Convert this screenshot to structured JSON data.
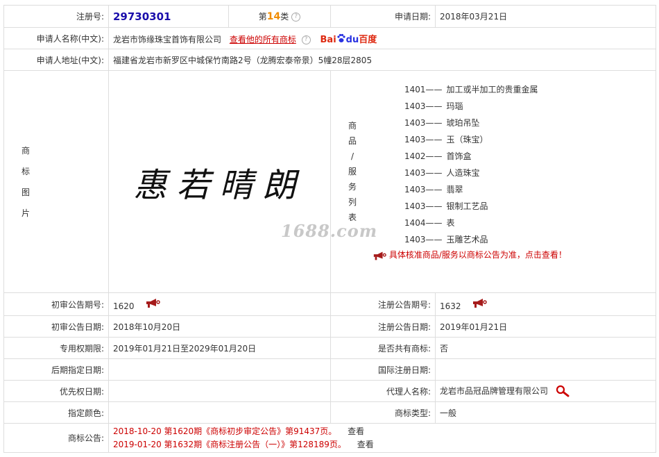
{
  "labels": {
    "reg_no": "注册号:",
    "apply_date": "申请日期:",
    "applicant_name": "申请人名称(中文):",
    "applicant_addr": "申请人地址(中文):",
    "mark_image": [
      "商",
      "标",
      "图",
      "片"
    ],
    "goods_services": [
      "商",
      "品",
      "/",
      "服",
      "务",
      "列",
      "表"
    ],
    "prelim_pub_no": "初审公告期号:",
    "reg_pub_no": "注册公告期号:",
    "prelim_pub_date": "初审公告日期:",
    "reg_pub_date": "注册公告日期:",
    "exclusive_period": "专用权期限:",
    "shared_mark": "是否共有商标:",
    "later_designation": "后期指定日期:",
    "intl_reg_date": "国际注册日期:",
    "priority_date": "优先权日期:",
    "agent_name": "代理人名称:",
    "designated_color": "指定颜色:",
    "mark_type": "商标类型:",
    "mark_announcement": "商标公告:"
  },
  "record": {
    "reg_no": "29730301",
    "class_prefix": "第",
    "class_num": "14",
    "class_suffix": "类",
    "apply_date": "2018年03月21日",
    "applicant_name": "龙岩市饰缘珠宝首饰有限公司",
    "view_all_link": "查看他的所有商标",
    "baidu": {
      "a": "Bai",
      "b": "du",
      "c": "百度"
    },
    "applicant_addr": "福建省龙岩市新罗区中城保竹南路2号（龙腾宏泰帝景）5幢28层2805",
    "mark_text": "惠若晴朗",
    "prelim_pub_no": "1620",
    "reg_pub_no": "1632",
    "prelim_pub_date": "2018年10月20日",
    "reg_pub_date": "2019年01月21日",
    "exclusive_period": "2019年01月21日至2029年01月20日",
    "shared_mark": "否",
    "later_designation": "",
    "intl_reg_date": "",
    "priority_date": "",
    "agent_name": "龙岩市品冠品牌管理有限公司",
    "designated_color": "",
    "mark_type": "一般"
  },
  "goods": [
    {
      "code": "1401",
      "name": "加工或半加工的贵重金属"
    },
    {
      "code": "1403",
      "name": "玛瑙"
    },
    {
      "code": "1403",
      "name": "琥珀吊坠"
    },
    {
      "code": "1403",
      "name": "玉（珠宝）"
    },
    {
      "code": "1402",
      "name": "首饰盒"
    },
    {
      "code": "1403",
      "name": "人造珠宝"
    },
    {
      "code": "1403",
      "name": "翡翠"
    },
    {
      "code": "1403",
      "name": "银制工艺品"
    },
    {
      "code": "1404",
      "name": "表"
    },
    {
      "code": "1403",
      "name": "玉雕艺术品"
    }
  ],
  "goods_dash": "——",
  "goods_note": "具体核准商品/服务以商标公告为准，点击查看！",
  "watermark": "1688.com",
  "announcements": [
    {
      "text": "2018-10-20 第1620期《商标初步审定公告》第91437页。",
      "action": "查看"
    },
    {
      "text": "2019-01-20 第1632期《商标注册公告（一）》第128189页。",
      "action": "查看"
    }
  ],
  "colors": {
    "link_red": "#cc0000",
    "reg_no": "#1a0dab",
    "class_num": "#f08c00"
  }
}
